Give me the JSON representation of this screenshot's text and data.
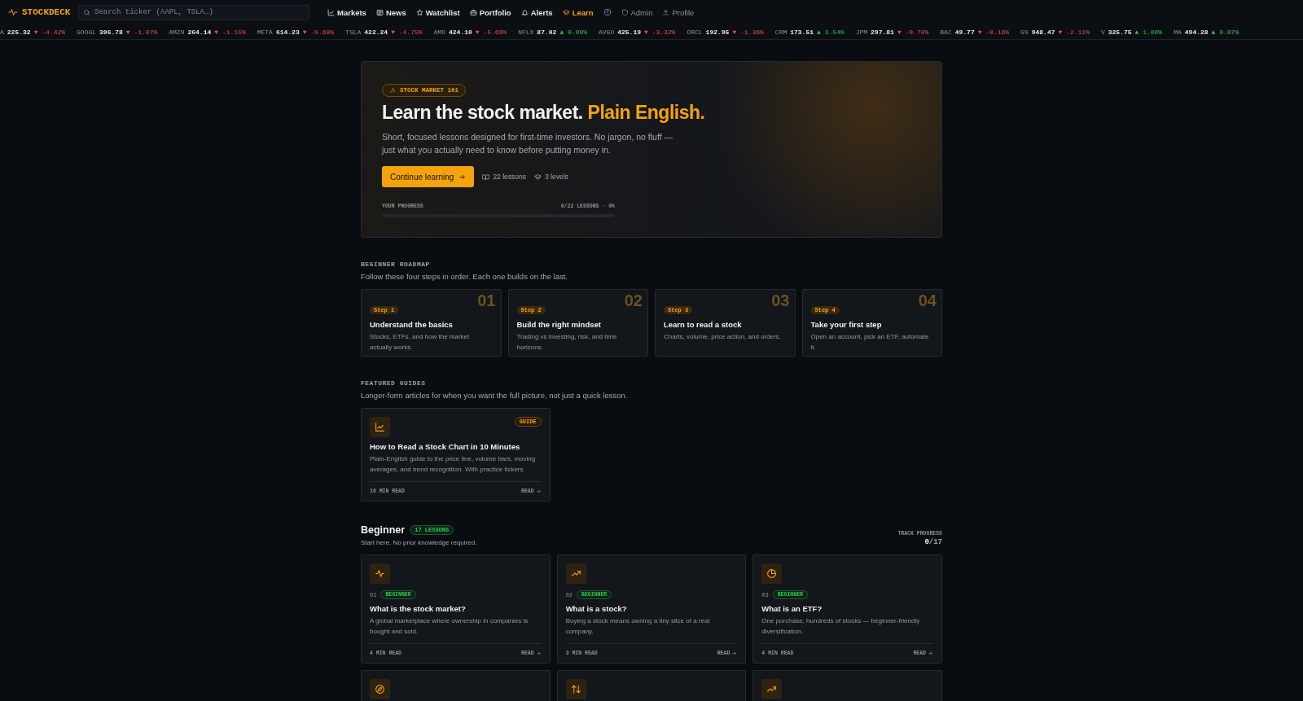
{
  "nav": {
    "brand": "STOCKDECK",
    "search": {
      "placeholder": "Search ticker (AAPL, TSLA…)"
    },
    "items": [
      {
        "label": "Markets",
        "selected": false,
        "muted": false
      },
      {
        "label": "News",
        "selected": false,
        "muted": false
      },
      {
        "label": "Watchlist",
        "selected": false,
        "muted": false
      },
      {
        "label": "Portfolio",
        "selected": false,
        "muted": false
      },
      {
        "label": "Alerts",
        "selected": false,
        "muted": false
      },
      {
        "label": "Learn",
        "selected": true,
        "muted": false
      },
      {
        "label": "Admin",
        "selected": false,
        "muted": true
      },
      {
        "label": "Profile",
        "selected": false,
        "muted": true
      }
    ]
  },
  "ticker": [
    {
      "symbol": "A",
      "price": "225.32",
      "arrow": "▼",
      "change": "-4.42%",
      "color": "#ef4b4b"
    },
    {
      "symbol": "GOOGL",
      "price": "396.78",
      "arrow": "▼",
      "change": "-1.07%",
      "color": "#ef4b4b"
    },
    {
      "symbol": "AMZN",
      "price": "264.14",
      "arrow": "▼",
      "change": "-1.15%",
      "color": "#ef4b4b"
    },
    {
      "symbol": "META",
      "price": "614.23",
      "arrow": "▼",
      "change": "-0.68%",
      "color": "#ef4b4b"
    },
    {
      "symbol": "TSLA",
      "price": "422.24",
      "arrow": "▼",
      "change": "-4.75%",
      "color": "#ef4b4b"
    },
    {
      "symbol": "AMD",
      "price": "424.10",
      "arrow": "▼",
      "change": "-5.69%",
      "color": "#ef4b4b"
    },
    {
      "symbol": "NFLX",
      "price": "87.02",
      "arrow": "▲",
      "change": "0.09%",
      "color": "#2bc553"
    },
    {
      "symbol": "AVGO",
      "price": "425.19",
      "arrow": "▼",
      "change": "-3.32%",
      "color": "#ef4b4b"
    },
    {
      "symbol": "ORCL",
      "price": "192.95",
      "arrow": "▼",
      "change": "-1.36%",
      "color": "#ef4b4b"
    },
    {
      "symbol": "CRM",
      "price": "173.51",
      "arrow": "▲",
      "change": "3.54%",
      "color": "#2bc553"
    },
    {
      "symbol": "JPM",
      "price": "297.81",
      "arrow": "▼",
      "change": "-0.70%",
      "color": "#ef4b4b"
    },
    {
      "symbol": "BAC",
      "price": "49.77",
      "arrow": "▼",
      "change": "-0.16%",
      "color": "#ef4b4b"
    },
    {
      "symbol": "GS",
      "price": "948.47",
      "arrow": "▼",
      "change": "-2.11%",
      "color": "#ef4b4b"
    },
    {
      "symbol": "V",
      "price": "325.75",
      "arrow": "▲",
      "change": "1.08%",
      "color": "#2bc553"
    },
    {
      "symbol": "MA",
      "price": "494.28",
      "arrow": "▲",
      "change": "0.87%",
      "color": "#2bc553"
    }
  ],
  "hero": {
    "badge": "STOCK MARKET 101",
    "title": "Learn the stock market.",
    "title_accent": "Plain English.",
    "description": "Short, focused lessons designed for first-time investors. No jargon, no fluff — just what you actually need to know before putting money in.",
    "button": "Continue learning",
    "lessons": "22 lessons",
    "levels": "3 levels",
    "progress_label": "YOUR PROGRESS",
    "progress_text": "0/22 LESSONS · 0%",
    "level": 0
  },
  "roadmap": {
    "label": "BEGINNER ROADMAP",
    "subtitle": "Follow these four steps in order. Each one builds on the last.",
    "steps": [
      {
        "step": "Step 1",
        "number": "01",
        "title": "Understand the basics",
        "description": "Stocks, ETFs, and how the market actually works."
      },
      {
        "step": "Step 2",
        "number": "02",
        "title": "Build the right mindset",
        "description": "Trading vs investing, risk, and time horizons."
      },
      {
        "step": "Step 3",
        "number": "03",
        "title": "Learn to read a stock",
        "description": "Charts, volume, price action, and orders."
      },
      {
        "step": "Step 4",
        "number": "04",
        "title": "Take your first step",
        "description": "Open an account, pick an ETF, automate it."
      }
    ]
  },
  "guides": {
    "label": "FEATURED GUIDES",
    "subtitle": "Longer-form articles for when you want the full picture, not just a quick lesson.",
    "items": [
      {
        "tag": "GUIDE",
        "title": "How to Read a Stock Chart in 10 Minutes",
        "description": "Plain-English guide to the price line, volume bars, moving averages, and trend recognition. With practice tickers.",
        "read_time": "10 MIN READ",
        "action": "READ"
      }
    ]
  },
  "track": {
    "title": "Beginner",
    "count": "17 LESSONS",
    "subtitle": "Start here. No prior knowledge required.",
    "progress_label": "TRACK PROGRESS",
    "progress_done": "0",
    "progress_total": "/17",
    "lessons": [
      {
        "kind": "full",
        "number": "01",
        "tag": "BEGINNER",
        "title": "What is the stock market?",
        "description": "A global marketplace where ownership in companies is bought and sold.",
        "read_time": "4 MIN READ",
        "action": "READ"
      },
      {
        "kind": "full",
        "number": "02",
        "tag": "BEGINNER",
        "title": "What is a stock?",
        "description": "Buying a stock means owning a tiny slice of a real company.",
        "read_time": "3 MIN READ",
        "action": "READ"
      },
      {
        "kind": "full",
        "number": "03",
        "tag": "BEGINNER",
        "title": "What is an ETF?",
        "description": "One purchase, hundreds of stocks — beginner-friendly diversification.",
        "read_time": "4 MIN READ",
        "action": "READ"
      },
      {
        "kind": "partial"
      },
      {
        "kind": "partial"
      },
      {
        "kind": "partial"
      }
    ]
  }
}
